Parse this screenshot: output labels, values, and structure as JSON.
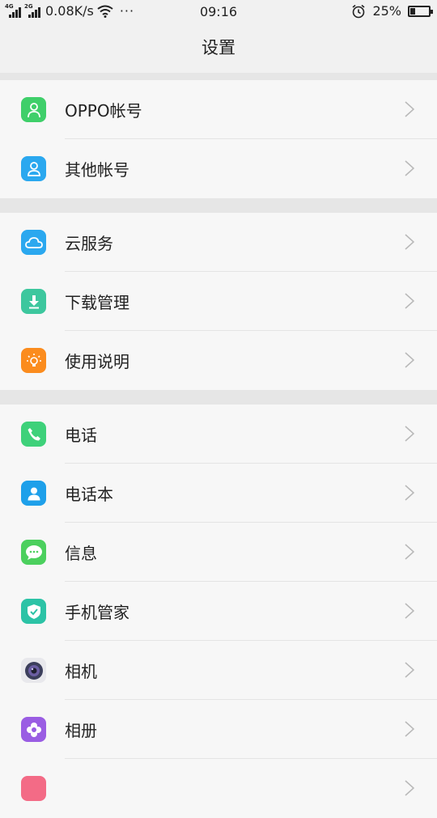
{
  "status_bar": {
    "signal1_label": "4G",
    "signal2_label": "2G",
    "net_speed": "0.08K/s",
    "more": "···",
    "time": "09:16",
    "battery_pct": "25%",
    "battery_level": 0.25
  },
  "header": {
    "title": "设置"
  },
  "groups": [
    {
      "items": [
        {
          "label": "OPPO帐号",
          "icon": "account-icon",
          "color": "#3fcf6a"
        },
        {
          "label": "其他帐号",
          "icon": "user-outline-icon",
          "color": "#2ba8ef"
        }
      ]
    },
    {
      "items": [
        {
          "label": "云服务",
          "icon": "cloud-icon",
          "color": "#2ba8ef"
        },
        {
          "label": "下载管理",
          "icon": "download-icon",
          "color": "#3dc79e"
        },
        {
          "label": "使用说明",
          "icon": "lightbulb-icon",
          "color": "#fb8c1e"
        }
      ]
    },
    {
      "items": [
        {
          "label": "电话",
          "icon": "phone-icon",
          "color": "#3ed17a"
        },
        {
          "label": "电话本",
          "icon": "contacts-icon",
          "color": "#1ea0ea"
        },
        {
          "label": "信息",
          "icon": "message-icon",
          "color": "#4cd05e"
        },
        {
          "label": "手机管家",
          "icon": "shield-icon",
          "color": "#2cc3a6"
        },
        {
          "label": "相机",
          "icon": "camera-icon",
          "color": "#e8e8ec"
        },
        {
          "label": "相册",
          "icon": "gallery-icon",
          "color": "#9a5de3"
        },
        {
          "label": "",
          "icon": "app-icon",
          "color": "#f36b86"
        }
      ]
    }
  ]
}
